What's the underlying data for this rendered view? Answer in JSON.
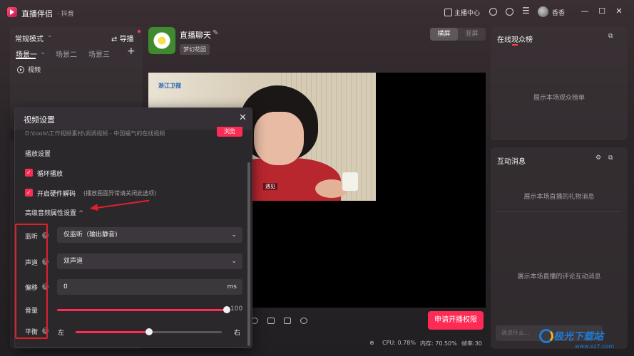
{
  "titlebar": {
    "app_name": "直播伴侣",
    "app_sub": "· 抖音",
    "host_center": "主播中心",
    "username": "香香"
  },
  "left_panel": {
    "mode": "常规模式",
    "guide": "导播",
    "scenes": [
      "场景一",
      "场景二",
      "场景三"
    ],
    "source": "视频"
  },
  "room": {
    "title": "直播聊天",
    "tag": "梦幻花园",
    "orient_landscape": "横屏",
    "orient_portrait": "竖屏"
  },
  "preview": {
    "channel_logo": "浙江卫视",
    "caption": "遇见"
  },
  "apply_button": "申请开播权限",
  "status": {
    "cpu": "CPU: 0.78%",
    "mem": "内存: 70.50%",
    "fps": "帧率:30"
  },
  "right_panel": {
    "audience_title": "在线观众榜",
    "audience_empty": "展示本场观众榜单",
    "interact_title": "互动消息",
    "gift_empty": "展示本场直播的礼物消息",
    "comment_empty": "展示本场直播的评论互动消息",
    "chat_placeholder": "说点什么..."
  },
  "modal": {
    "title": "视频设置",
    "path": "D:\\tools\\工作视频素材\\调调视频 - 中国福气的在线视频",
    "browse": "浏览",
    "playback_section": "播放设置",
    "loop_label": "循环播放",
    "hw_label": "开启硬件解码",
    "hw_hint": "(播放画面异常请关闭此选项)",
    "advanced_section": "高级音频属性设置",
    "monitor_label": "监听",
    "monitor_value": "仅监听（输出静音)",
    "channel_label": "声道",
    "channel_value": "双声道",
    "offset_label": "偏移",
    "offset_value": "0",
    "offset_unit": "ms",
    "volume_label": "音量",
    "volume_value": "100",
    "volume_level": 1.0,
    "balance_label": "平衡",
    "balance_left": "左",
    "balance_right": "右",
    "balance_level": 0.5
  },
  "watermark": {
    "brand": "极光下载站",
    "url": "www.xz7.com"
  },
  "colors": {
    "accent": "#fe2c55",
    "annotation": "#e0202b"
  }
}
